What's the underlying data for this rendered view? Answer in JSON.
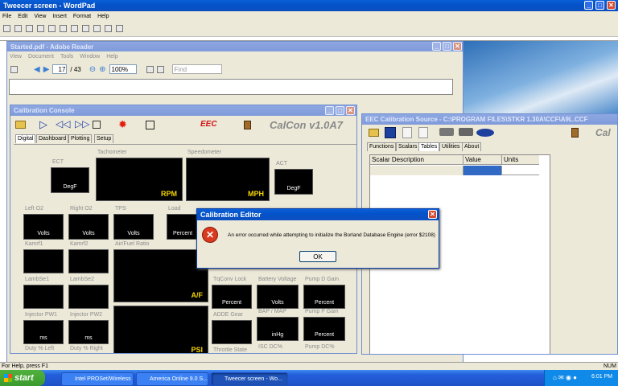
{
  "wordpad": {
    "title": "Tweecer screen - WordPad",
    "menu": [
      "File",
      "Edit",
      "View",
      "Insert",
      "Format",
      "Help"
    ],
    "status": "For Help, press F1",
    "num": "NUM"
  },
  "reader": {
    "title": "Started.pdf - Adobe Reader",
    "menu": [
      "View",
      "Document",
      "Tools",
      "Window",
      "Help"
    ],
    "page": "17",
    "pages": "/ 43",
    "zoom": "100%",
    "find_placeholder": "Find"
  },
  "console": {
    "title": "Calibration Console",
    "logo": "CalCon v1.0A7",
    "ecc": "EEC",
    "tabs": [
      "Digital",
      "Dashboard",
      "Plotting",
      "Setup"
    ],
    "gauges": {
      "ect": {
        "label": "ECT",
        "unit": "DegF"
      },
      "tach": {
        "label": "Tachometer",
        "unit": "RPM"
      },
      "speed": {
        "label": "Speedometer",
        "unit": "MPH"
      },
      "act": {
        "label": "ACT",
        "unit": "DegF"
      },
      "lefto2": {
        "label": "Left O2",
        "unit": "Volts"
      },
      "righto2": {
        "label": "Right O2",
        "unit": "Volts"
      },
      "tps": {
        "label": "TPS",
        "unit": "Volts"
      },
      "load": {
        "label": "Load",
        "unit": "Percent"
      },
      "kamr1": {
        "label": "Kamrf1"
      },
      "kamr2": {
        "label": "Kamrf2"
      },
      "afr": {
        "label": "Air/Fuel Ratio",
        "unit": "A/F"
      },
      "lambse1": {
        "label": "LambSe1"
      },
      "lambse2": {
        "label": "LambSe2"
      },
      "tqconv": {
        "label": "TqConv Lock",
        "unit": "Percent"
      },
      "batt": {
        "label": "Battery Voltage",
        "unit": "Volts"
      },
      "pumpd": {
        "label": "Pump D Gain",
        "unit": "Percent"
      },
      "injl": {
        "label": "Injector PW1",
        "unit": "ms"
      },
      "injr": {
        "label": "Injector PW2",
        "unit": "ms"
      },
      "psi": {
        "unit": "PSI"
      },
      "gear": {
        "label": "ADDE Gear"
      },
      "bap": {
        "label": "BAP / MAP",
        "unit": "inHg"
      },
      "pumpp": {
        "label": "Pump P Gain",
        "unit": "Percent"
      },
      "dutyl": {
        "label": "Duty % Left"
      },
      "dutyr": {
        "label": "Duty % Right"
      },
      "throttle": {
        "label": "Throttle State"
      },
      "iscdc": {
        "label": "ISC DC%"
      },
      "pumpdc": {
        "label": "Pump DC%"
      }
    }
  },
  "eec": {
    "title": "EEC Calibration Source - C:\\PROGRAM FILES\\STKR 1.30A\\CCF\\A9L.CCF",
    "tabs": [
      "Functions",
      "Scalars",
      "Tables",
      "Utilities",
      "About"
    ],
    "active_tab": "Tables",
    "cols": [
      "Scalar Description",
      "Value",
      "Units"
    ]
  },
  "dialog": {
    "title": "Calibration Editor",
    "message": "An error occurred while attempting to initialize the Borland Database Engine (error $2108)",
    "ok": "OK"
  },
  "taskbar": {
    "start": "start",
    "items": [
      "Intel PROSet/Wireless",
      "America Online 9.0 S...",
      "Tweecer screen - Wo..."
    ],
    "time": "6:01 PM"
  },
  "colors": {
    "xp_blue": "#0453c9",
    "taskbar": "#245edb",
    "start": "#3c9a2e",
    "error": "#d93a1f"
  }
}
